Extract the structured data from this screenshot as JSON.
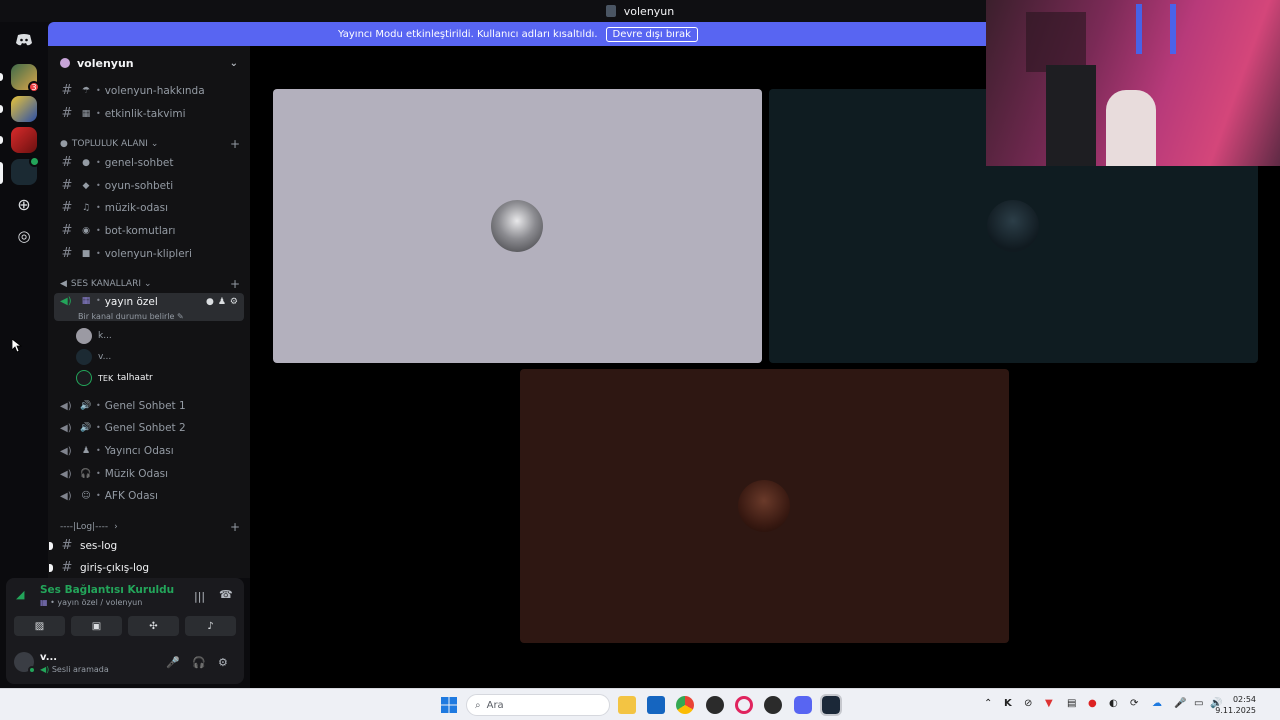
{
  "window": {
    "title": "volenyun"
  },
  "banner": {
    "message": "Yayıncı Modu etkinleştirildi. Kullanıcı adları kısaltıldı.",
    "button": "Devre dışı bırak"
  },
  "rail": {
    "badges": [
      "3"
    ]
  },
  "server": {
    "name": "volenyun"
  },
  "top_channels": [
    {
      "emoji": "☂",
      "name": "volenyun-hakkında"
    },
    {
      "emoji": "▦",
      "name": "etkinlik-takvimi"
    }
  ],
  "categories": {
    "community": "TOPLULUK ALANI",
    "voice": "SES KANALLARI",
    "log": "----|Log|----"
  },
  "community_channels": [
    {
      "emoji": "●",
      "name": "genel-sohbet"
    },
    {
      "emoji": "◆",
      "name": "oyun-sohbeti"
    },
    {
      "emoji": "♫",
      "name": "müzik-odası"
    },
    {
      "emoji": "◉",
      "name": "bot-komutları"
    },
    {
      "emoji": "■",
      "name": "volenyun-klipleri"
    }
  ],
  "active_voice": {
    "name": "yayın özel",
    "status_prompt": "Bir kanal durumu belirle",
    "members": [
      "k...",
      "v...",
      "talhaatr"
    ]
  },
  "voice_channels": [
    {
      "emoji": "🔊",
      "name": "Genel Sohbet 1"
    },
    {
      "emoji": "🔊",
      "name": "Genel Sohbet 2"
    },
    {
      "emoji": "♟",
      "name": "Yayıncı Odası"
    },
    {
      "emoji": "🎧",
      "name": "Müzik Odası"
    },
    {
      "emoji": "☺",
      "name": "AFK Odası"
    }
  ],
  "log_channels": [
    "ses-log",
    "giriş-çıkış-log"
  ],
  "voice_panel": {
    "status": "Ses Bağlantısı Kuruldu",
    "location": "yayın özel / volenyun"
  },
  "user_panel": {
    "name": "v...",
    "status": "Sesli aramada"
  },
  "taskbar": {
    "search_placeholder": "Ara",
    "time": "02:54",
    "date": "9.11.2025"
  },
  "colors": {
    "accent": "#5865f2",
    "online": "#23a55a",
    "tile1": "#b3b0bd",
    "tile2": "#0f1c21",
    "tile3": "#2e1712"
  }
}
